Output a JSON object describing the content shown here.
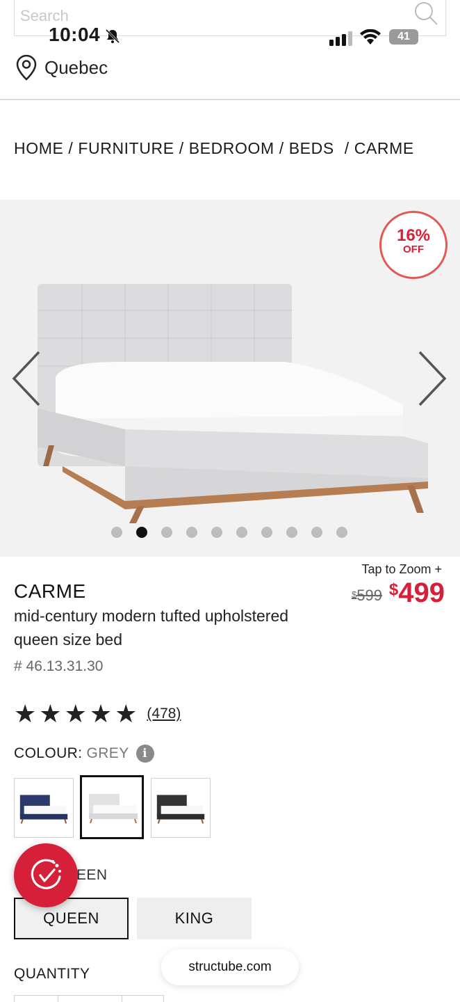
{
  "search": {
    "placeholder": "Search"
  },
  "status_bar": {
    "time": "10:04",
    "battery": "41"
  },
  "location": {
    "label": "Quebec"
  },
  "breadcrumb": {
    "items": [
      "HOME",
      "FURNITURE",
      "BEDROOM",
      "BEDS",
      "CARME"
    ],
    "separator": "/"
  },
  "gallery": {
    "badge_percent": "16%",
    "badge_off": "OFF",
    "slide_count": 10,
    "active_slide": 2
  },
  "product": {
    "tap_to_zoom": "Tap to Zoom +",
    "price_old_symbol": "$",
    "price_old": "599",
    "price_new_symbol": "$",
    "price_new": "499",
    "name": "CARME",
    "description": "mid-century modern tufted upholstered queen size bed",
    "sku": "# 46.13.31.30",
    "rating_stars": 5,
    "review_count": "(478)"
  },
  "colour": {
    "label": "COLOUR:",
    "value": "GREY",
    "info_icon": "i",
    "swatches": [
      {
        "name": "navy",
        "color": "#2b3a6b"
      },
      {
        "name": "grey",
        "color": "#e6e6e6"
      },
      {
        "name": "charcoal",
        "color": "#333333"
      }
    ]
  },
  "size": {
    "label_visible": "EEN",
    "options": [
      "QUEEN",
      "KING"
    ],
    "selected": "QUEEN"
  },
  "quantity": {
    "label": "QUANTITY"
  },
  "browser": {
    "url": "structube.com"
  },
  "colors": {
    "accent": "#d6203a",
    "badge_border": "#e05a55"
  }
}
